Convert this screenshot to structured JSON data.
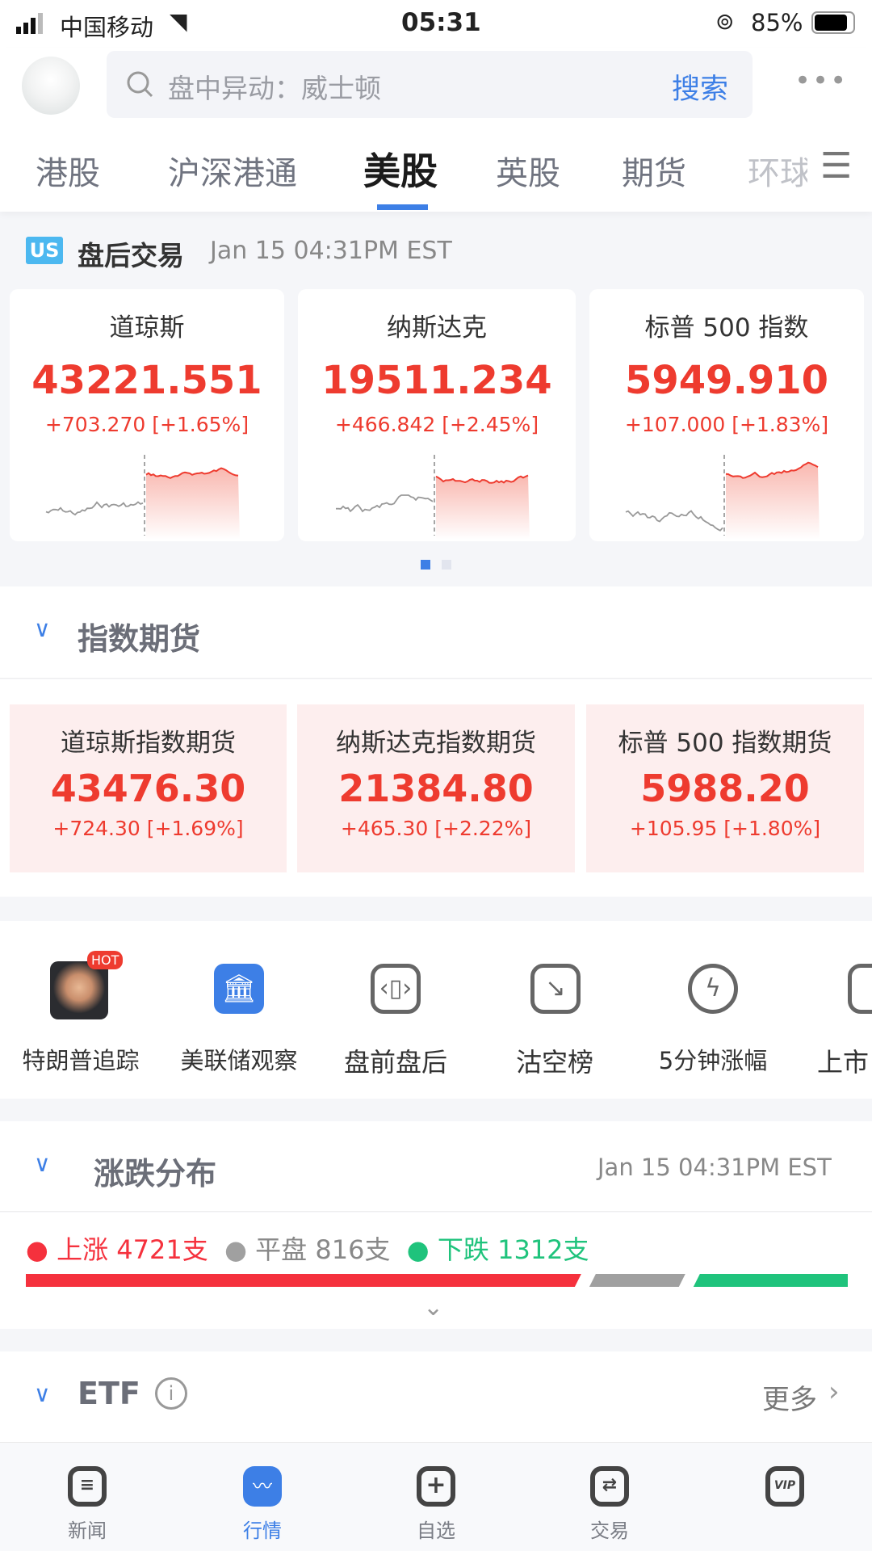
{
  "status_bar": {
    "carrier": "中国移动",
    "time": "05:31",
    "battery": "85%"
  },
  "header": {
    "search_placeholder": "盘中异动：威士顿",
    "search_button": "搜索"
  },
  "tabs": [
    {
      "label": "港股"
    },
    {
      "label": "沪深港通"
    },
    {
      "label": "美股",
      "active": true
    },
    {
      "label": "英股"
    },
    {
      "label": "期货"
    },
    {
      "label": "环球"
    }
  ],
  "session": {
    "badge": "US",
    "title": "盘后交易",
    "time": "Jan 15 04:31PM EST"
  },
  "indices": [
    {
      "name": "道琼斯",
      "value": "43221.551",
      "change": "+703.270 [+1.65%]"
    },
    {
      "name": "纳斯达克",
      "value": "19511.234",
      "change": "+466.842 [+2.45%]"
    },
    {
      "name": "标普 500 指数",
      "value": "5949.910",
      "change": "+107.000 [+1.83%]"
    }
  ],
  "futures_section": {
    "title": "指数期货"
  },
  "futures": [
    {
      "name": "道琼斯指数期货",
      "value": "43476.30",
      "change": "+724.30 [+1.69%]"
    },
    {
      "name": "纳斯达克指数期货",
      "value": "21384.80",
      "change": "+465.30 [+2.22%]"
    },
    {
      "name": "标普 500 指数期货",
      "value": "5988.20",
      "change": "+105.95 [+1.80%]"
    }
  ],
  "quick": [
    {
      "label": "特朗普追踪",
      "icon": "trump-photo-icon",
      "badge": "HOT"
    },
    {
      "label": "美联储观察",
      "icon": "bank-icon"
    },
    {
      "label": "盘前盘后",
      "icon": "candlestick-icon"
    },
    {
      "label": "沽空榜",
      "icon": "short-chart-icon"
    },
    {
      "label": "5分钟涨幅",
      "icon": "5min-gauge-icon"
    },
    {
      "label": "上市",
      "icon": "ipo-icon"
    }
  ],
  "distribution": {
    "title": "涨跌分布",
    "time": "Jan 15 04:31PM EST",
    "up_label": "上涨",
    "up": "4721",
    "flat_label": "平盘",
    "flat": "816",
    "down_label": "下跌",
    "down": "1312",
    "unit": "支",
    "colors": {
      "up": "#f5313d",
      "flat": "#a0a0a0",
      "down": "#1fc37c"
    }
  },
  "etf": {
    "title": "ETF",
    "more": "更多"
  },
  "bottom_nav": [
    {
      "label": "新闻"
    },
    {
      "label": "行情",
      "active": true
    },
    {
      "label": "自选"
    },
    {
      "label": "交易"
    },
    {
      "label": "VIP"
    }
  ],
  "colors": {
    "accent": "#3d7fe6",
    "up": "#ee3b2f"
  }
}
